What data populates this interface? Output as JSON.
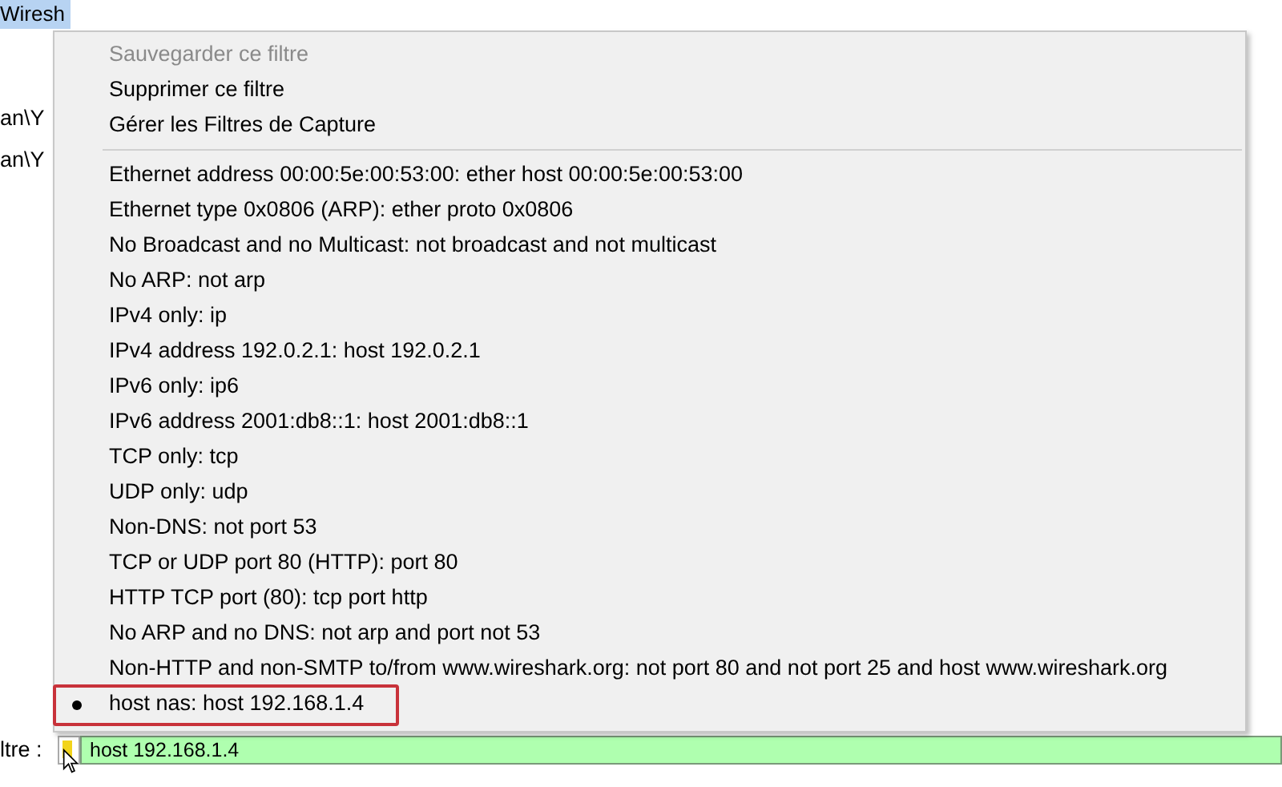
{
  "background": {
    "title": "Wiresh",
    "lines": [
      "an\\Y",
      "an\\Y"
    ]
  },
  "menu": {
    "actions": [
      {
        "label": "Sauvegarder ce filtre",
        "disabled": true
      },
      {
        "label": "Supprimer ce filtre",
        "disabled": false
      },
      {
        "label": "Gérer les Filtres de Capture",
        "disabled": false
      }
    ],
    "filters": [
      {
        "label": "Ethernet address 00:00:5e:00:53:00: ether host 00:00:5e:00:53:00",
        "selected": false
      },
      {
        "label": "Ethernet type 0x0806 (ARP): ether proto 0x0806",
        "selected": false
      },
      {
        "label": "No Broadcast and no Multicast: not broadcast and not multicast",
        "selected": false
      },
      {
        "label": "No ARP: not arp",
        "selected": false
      },
      {
        "label": "IPv4 only: ip",
        "selected": false
      },
      {
        "label": "IPv4 address 192.0.2.1: host 192.0.2.1",
        "selected": false
      },
      {
        "label": "IPv6 only: ip6",
        "selected": false
      },
      {
        "label": "IPv6 address 2001:db8::1: host 2001:db8::1",
        "selected": false
      },
      {
        "label": "TCP only: tcp",
        "selected": false
      },
      {
        "label": "UDP only: udp",
        "selected": false
      },
      {
        "label": "Non-DNS: not port 53",
        "selected": false
      },
      {
        "label": "TCP or UDP port 80 (HTTP): port 80",
        "selected": false
      },
      {
        "label": "HTTP TCP port (80): tcp port http",
        "selected": false
      },
      {
        "label": "No ARP and no DNS: not arp and port not 53",
        "selected": false
      },
      {
        "label": "Non-HTTP and non-SMTP to/from www.wireshark.org: not port 80 and not port 25 and host www.wireshark.org",
        "selected": false
      },
      {
        "label": "host nas: host 192.168.1.4",
        "selected": true
      }
    ]
  },
  "filter_bar": {
    "label": "ltre :",
    "value": "host 192.168.1.4"
  }
}
